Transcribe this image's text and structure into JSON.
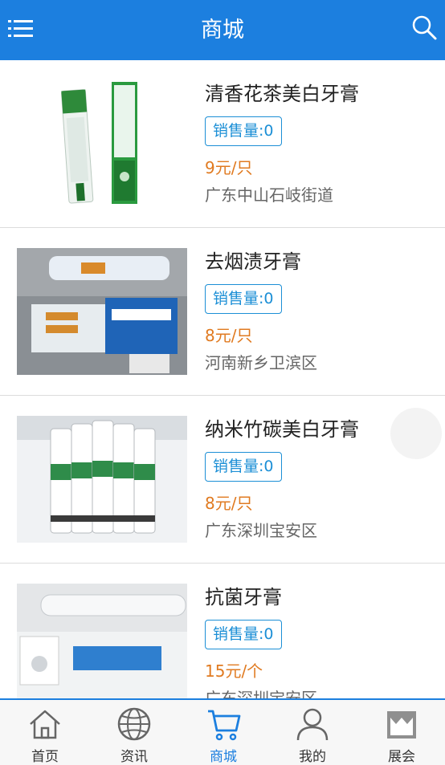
{
  "header": {
    "title": "商城",
    "menu_icon": "menu-icon",
    "search_icon": "search-icon"
  },
  "products": [
    {
      "name": "清香花茶美白牙膏",
      "sales": "销售量:0",
      "price": "9元/只",
      "location": "广东中山石岐街道"
    },
    {
      "name": "去烟渍牙膏",
      "sales": "销售量:0",
      "price": "8元/只",
      "location": "河南新乡卫滨区"
    },
    {
      "name": "纳米竹碳美白牙膏",
      "sales": "销售量:0",
      "price": "8元/只",
      "location": "广东深圳宝安区"
    },
    {
      "name": "抗菌牙膏",
      "sales": "销售量:0",
      "price": "15元/个",
      "location": "广东深圳宝安区"
    }
  ],
  "tabs": [
    {
      "label": "首页",
      "icon": "home-icon"
    },
    {
      "label": "资讯",
      "icon": "globe-icon"
    },
    {
      "label": "商城",
      "icon": "cart-icon"
    },
    {
      "label": "我的",
      "icon": "user-icon"
    },
    {
      "label": "展会",
      "icon": "store-icon"
    }
  ],
  "colors": {
    "primary": "#1c7fdf",
    "price": "#e07a20",
    "sales_badge": "#1c8fd6"
  }
}
